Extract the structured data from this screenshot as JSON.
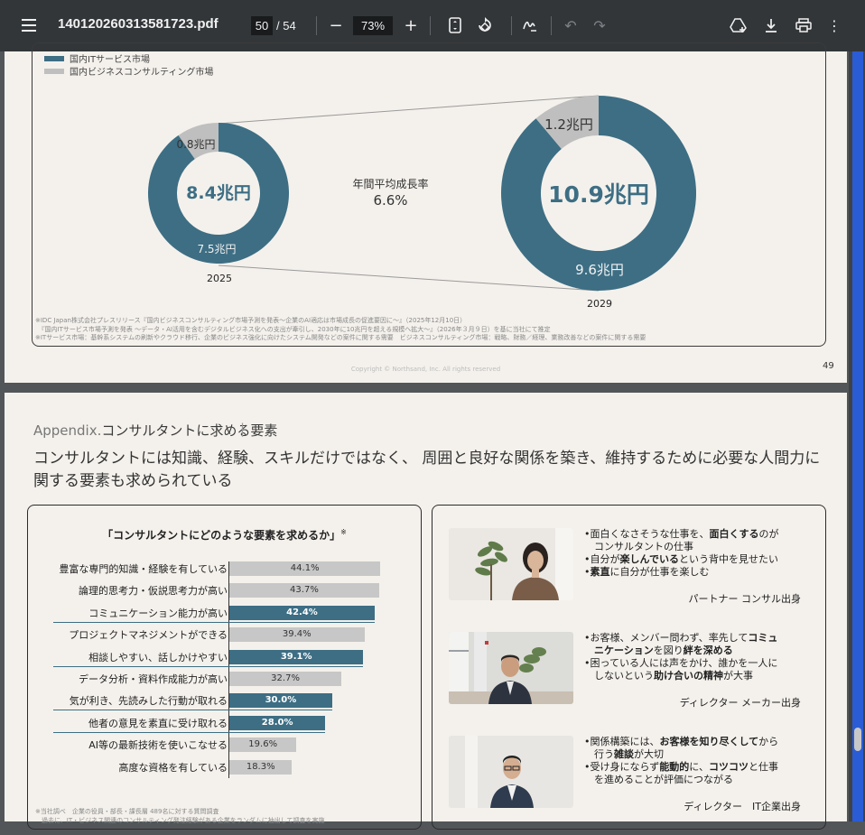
{
  "viewer": {
    "doc_title": "140120260313581723.pdf",
    "current_page": "50",
    "total_pages": "/ 54",
    "zoom": "73%",
    "icons": [
      "menu-icon",
      "zoom-out-icon",
      "zoom-in-icon",
      "fit-page-icon",
      "rotate-icon",
      "annotate-icon",
      "undo-icon",
      "redo-icon",
      "add-to-drive-icon",
      "download-icon",
      "print-icon",
      "more-icon"
    ]
  },
  "page49": {
    "legend": [
      {
        "label": "国内ITサービス市場",
        "color": "#3d6e84"
      },
      {
        "label": "国内ビジネスコンサルティング市場",
        "color": "#bfbfbf"
      }
    ],
    "growth_label": "年間平均成長率",
    "growth_value": "6.6%",
    "footnotes": [
      "※IDC Japan株式会社プレスリリース『国内ビジネスコンサルティング市場予測を発表～企業のAI適応は市場成長の促進要因に～』（2025年12月10日）",
      "　『国内ITサービス市場予測を発表 ～データ・AI活用を含むデジタルビジネス化への支出が牽引し、2030年に10兆円を超える規模へ拡大～』（2026年３月９日）を基に当社にて推定",
      "※ITサービス市場：基幹系システムの刷新やクラウド移行、企業のビジネス強化に向けたシステム開発などの案件に関する需要　ビジネスコンサルティング市場：戦略、財務／経理、業務改善などの案件に関する需要"
    ],
    "copyright": "Copyright © Northsand, Inc. All rights reserved",
    "page_number": "49"
  },
  "chart_data": [
    {
      "type": "pie",
      "subtype": "donut",
      "category": "2025",
      "total_label": "8.4兆円",
      "slices": [
        {
          "name": "国内ITサービス市場",
          "value": 7.5,
          "label": "7.5兆円",
          "color": "#3d6e84"
        },
        {
          "name": "国内ビジネスコンサルティング市場",
          "value": 0.8,
          "label": "0.8兆円",
          "color": "#bfbfbf"
        }
      ]
    },
    {
      "type": "pie",
      "subtype": "donut",
      "category": "2029",
      "total_label": "10.9兆円",
      "slices": [
        {
          "name": "国内ITサービス市場",
          "value": 9.6,
          "label": "9.6兆円",
          "color": "#3d6e84"
        },
        {
          "name": "国内ビジネスコンサルティング市場",
          "value": 1.2,
          "label": "1.2兆円",
          "color": "#bfbfbf"
        }
      ]
    },
    {
      "type": "bar",
      "orientation": "horizontal",
      "title": "「コンサルタントにどのような要素を求めるか」",
      "title_mark": "※",
      "categories": [
        "豊富な専門的知識・経験を有している",
        "論理的思考力・仮説思考力が高い",
        "コミュニケーション能力が高い",
        "プロジェクトマネジメントができる",
        "相談しやすい、話しかけやすい",
        "データ分析・資料作成能力が高い",
        "気が利き、先読みした行動が取れる",
        "他者の意見を素直に受け取れる",
        "AI等の最新技術を使いこなせる",
        "高度な資格を有している"
      ],
      "values": [
        44.1,
        43.7,
        42.4,
        39.4,
        39.1,
        32.7,
        30.0,
        28.0,
        19.6,
        18.3
      ],
      "value_labels": [
        "44.1%",
        "43.7%",
        "42.4%",
        "39.4%",
        "39.1%",
        "32.7%",
        "30.0%",
        "28.0%",
        "19.6%",
        "18.3%"
      ],
      "highlighted": [
        false,
        false,
        true,
        false,
        true,
        false,
        true,
        true,
        false,
        false
      ],
      "colors": {
        "highlight": "#3d6e84",
        "normal": "#c7c7c7"
      },
      "xlim": [
        0,
        50
      ]
    }
  ],
  "page50": {
    "section": "Appendix.",
    "section_title": "コンサルタントに求める要素",
    "headline": "コンサルタントには知識、経験、スキルだけではなく、 周囲と良好な関係を築き、維持するために必要な人間力に関する要素も求められている",
    "survey_footnotes": [
      "※当社調べ　企業の役員・部長・課長層 489名に対する質問調査",
      "　過去に、IT・ビジネス関連のコンサルティング発注経験がある企業をランダムに抽出して調査を実施"
    ],
    "profiles": [
      {
        "lines": [
          [
            [
              "•面白くなさそうな仕事を、",
              false
            ],
            [
              "面白くする",
              true
            ],
            [
              "のが",
              false
            ]
          ],
          [
            [
              "　コンサルタントの仕事",
              false
            ]
          ],
          [
            [
              "•自分が",
              false
            ],
            [
              "楽しんでいる",
              true
            ],
            [
              "という背中を見せたい",
              false
            ]
          ],
          [
            [
              "•",
              false
            ],
            [
              "素直",
              true
            ],
            [
              "に自分が仕事を楽しむ",
              false
            ]
          ]
        ],
        "role": "パートナー コンサル出身"
      },
      {
        "lines": [
          [
            [
              "•お客様、メンバー問わず、率先して",
              false
            ],
            [
              "コミュ",
              true
            ]
          ],
          [
            [
              "　",
              false
            ],
            [
              "ニケーション",
              true
            ],
            [
              "を図り",
              false
            ],
            [
              "絆を深める",
              true
            ]
          ],
          [
            [
              "•困っている人には声をかけ、誰かを一人に",
              false
            ]
          ],
          [
            [
              "　しないという",
              false
            ],
            [
              "助け合いの精神",
              true
            ],
            [
              "が大事",
              false
            ]
          ]
        ],
        "role": "ディレクター メーカー出身"
      },
      {
        "lines": [
          [
            [
              "•関係構築には、",
              false
            ],
            [
              "お客様を知り尽くして",
              true
            ],
            [
              "から",
              false
            ]
          ],
          [
            [
              "　行う",
              false
            ],
            [
              "雑談",
              true
            ],
            [
              "が大切",
              false
            ]
          ],
          [
            [
              "•受け身にならず",
              false
            ],
            [
              "能動的",
              true
            ],
            [
              "に、",
              false
            ],
            [
              "コツコツ",
              true
            ],
            [
              "と仕事",
              false
            ]
          ],
          [
            [
              "　を進めることが評価につながる",
              false
            ]
          ]
        ],
        "role": "ディレクター　IT企業出身"
      }
    ]
  }
}
